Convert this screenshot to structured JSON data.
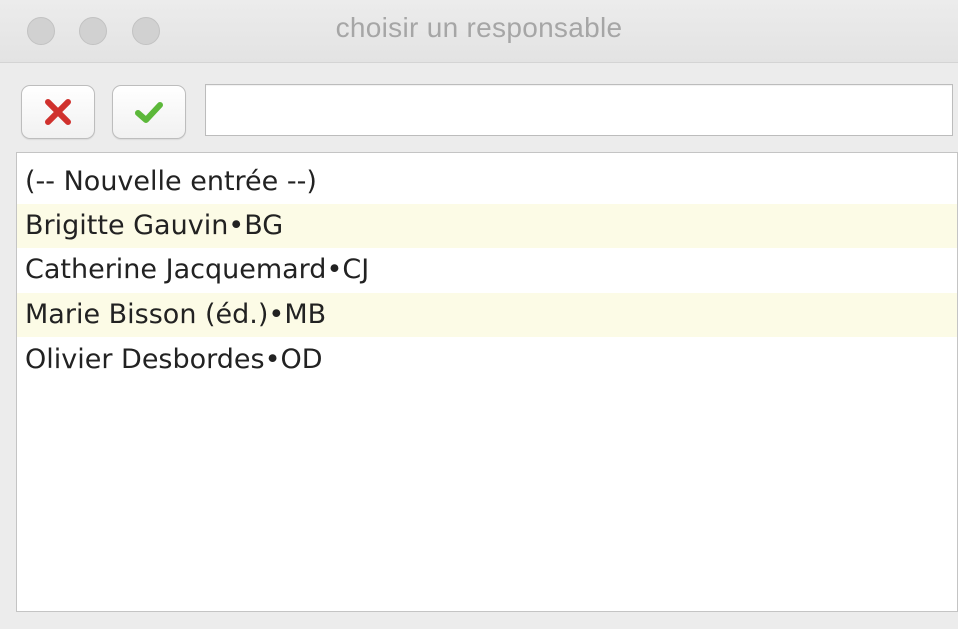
{
  "window": {
    "title": "choisir un responsable"
  },
  "toolbar": {
    "cancel_icon": "x-icon",
    "confirm_icon": "checkmark-icon",
    "search_value": ""
  },
  "list": {
    "items": [
      "(-- Nouvelle entrée --)",
      "Brigitte Gauvin•BG",
      "Catherine Jacquemard•CJ",
      "Marie Bisson (éd.)•MB",
      "Olivier Desbordes•OD"
    ]
  },
  "colors": {
    "cancel_red": "#d0312d",
    "confirm_green": "#5cb83a",
    "row_highlight": "#fcfbe6"
  }
}
